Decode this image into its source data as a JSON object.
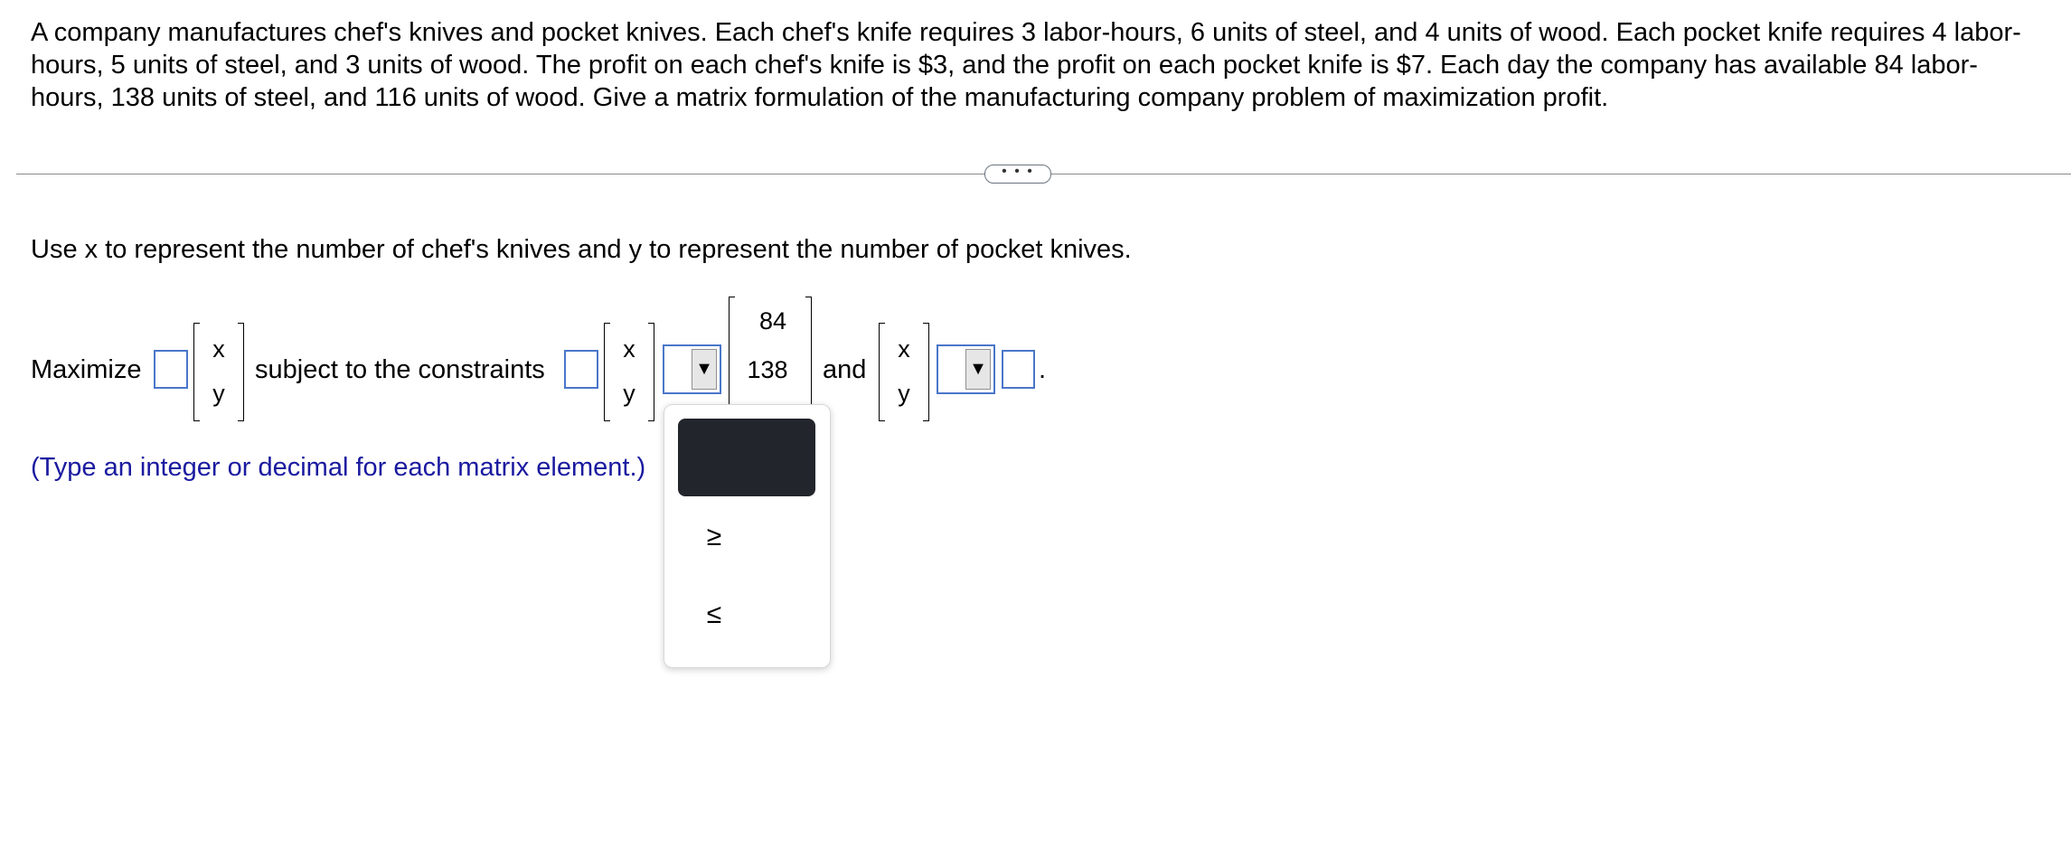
{
  "problem": {
    "text": "A company manufactures chef's knives and pocket knives. Each chef's knife requires 3 labor-hours, 6 units of steel, and 4 units of wood. Each pocket knife requires 4 labor-hours, 5 units of steel, and 3 units of wood. The profit on each chef's knife is $3, and the profit on each pocket knife is $7. Each day the company has available 84 labor-hours, 138 units of steel, and 116 units of wood. Give a matrix formulation of the manufacturing company problem of maximization profit."
  },
  "divider": {
    "expand_label": "• • •"
  },
  "instruction": "Use x to represent the number of chef's knives and y to represent the number of pocket knives.",
  "formulation": {
    "maximize_label": "Maximize",
    "subject_label": "subject to the constraints",
    "and_label": "and",
    "period": ".",
    "var_x": "x",
    "var_y": "y",
    "rhs": [
      "84",
      "138"
    ],
    "objective_coeff_value": "",
    "constraint_coeff_value": "",
    "nonneg_value": ""
  },
  "dropdown": {
    "arrow_icon": "▼",
    "options": [
      "≥",
      "≤"
    ],
    "selected_index": null
  },
  "hint": "(Type an integer or decimal for each matrix element.)"
}
